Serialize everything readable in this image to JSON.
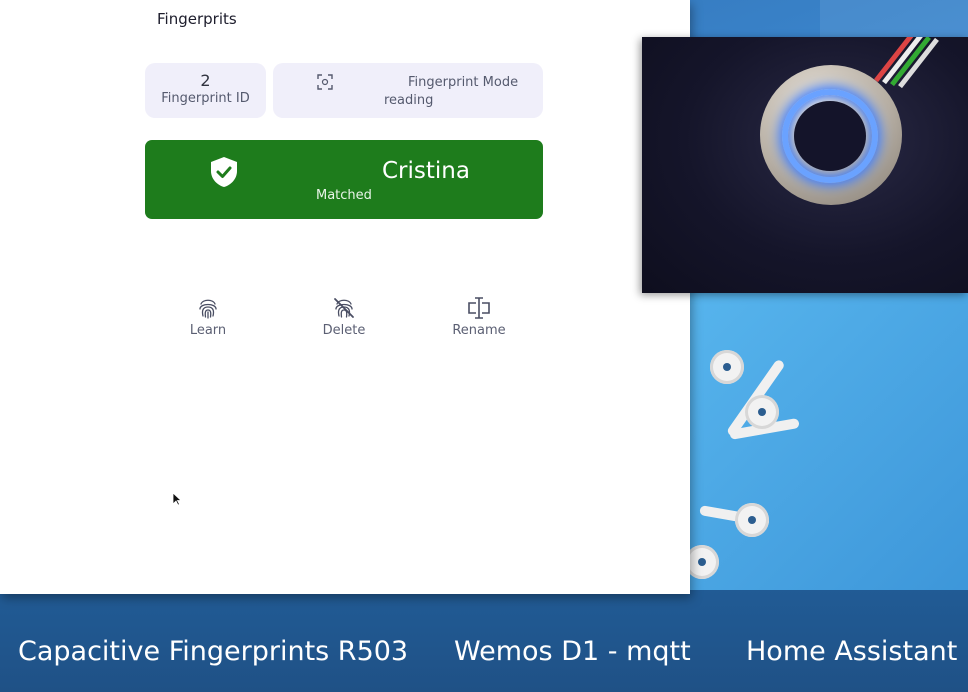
{
  "app": {
    "title": "Fingerprits"
  },
  "info": {
    "fingerprint_id_value": "2",
    "fingerprint_id_label": "Fingerprint ID",
    "mode_label": "Fingerprint Mode",
    "mode_value": "reading"
  },
  "match": {
    "name": "Cristina",
    "status": "Matched",
    "color": "#1e7c1c"
  },
  "actions": {
    "learn": "Learn",
    "delete": "Delete",
    "rename": "Rename"
  },
  "captions": {
    "left": "Capacitive Fingerprints R503",
    "middle": "Wemos D1 - mqtt",
    "right": "Home Assistant"
  },
  "icons": {
    "mode": "scan-frame-icon",
    "match": "shield-check-icon",
    "learn": "fingerprint-icon",
    "delete": "fingerprint-off-icon",
    "rename": "text-cursor-icon"
  }
}
